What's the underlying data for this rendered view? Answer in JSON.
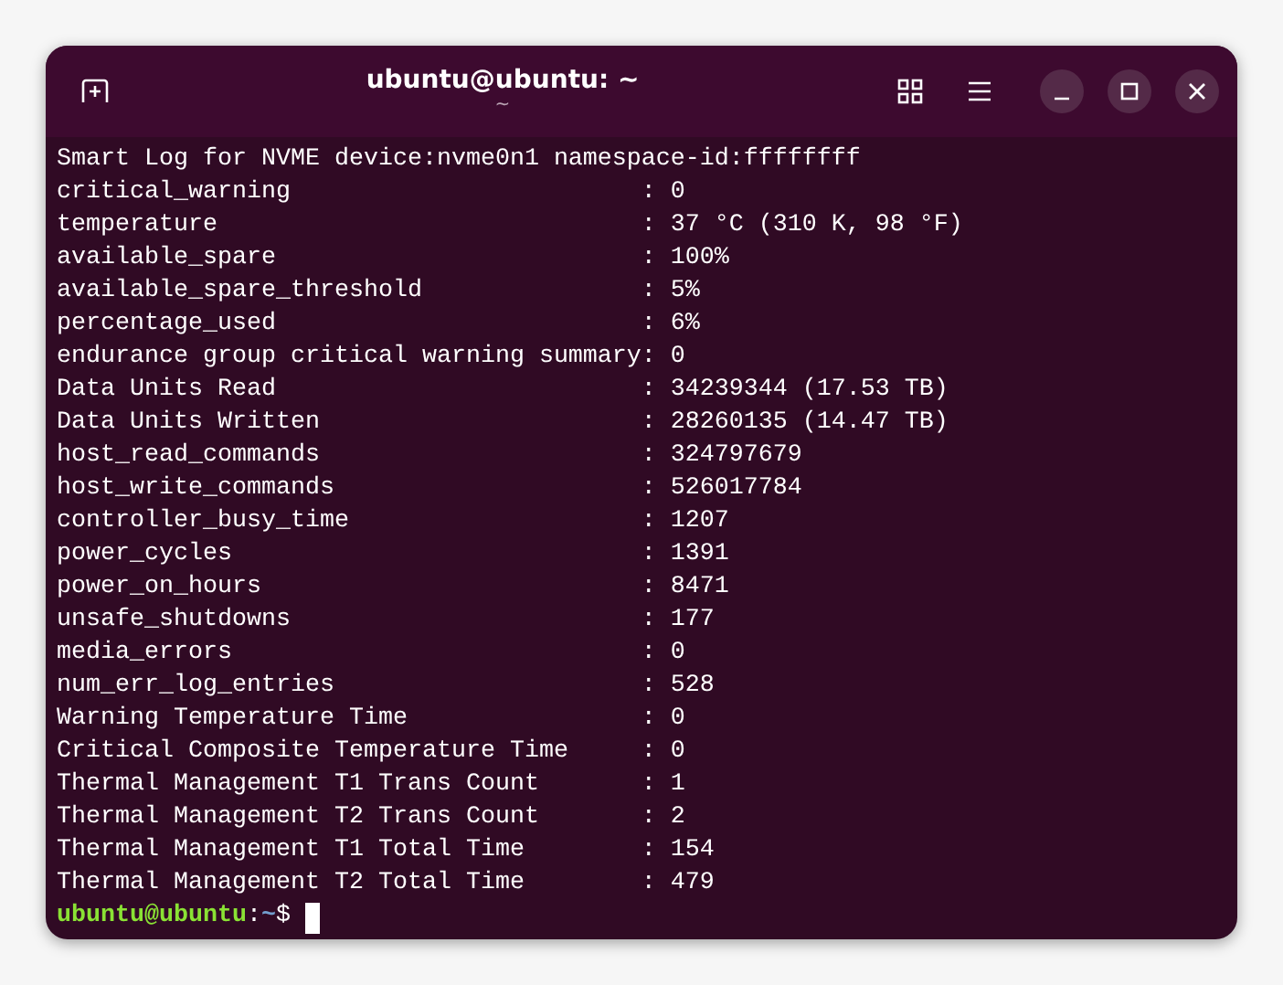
{
  "window": {
    "title": "ubuntu@ubuntu: ~",
    "subtitle": "~"
  },
  "terminal": {
    "lines": [
      "Smart Log for NVME device:nvme0n1 namespace-id:ffffffff",
      "critical_warning                        : 0",
      "temperature                             : 37 °C (310 K, 98 °F)",
      "available_spare                         : 100%",
      "available_spare_threshold               : 5%",
      "percentage_used                         : 6%",
      "endurance group critical warning summary: 0",
      "Data Units Read                         : 34239344 (17.53 TB)",
      "Data Units Written                      : 28260135 (14.47 TB)",
      "host_read_commands                      : 324797679",
      "host_write_commands                     : 526017784",
      "controller_busy_time                    : 1207",
      "power_cycles                            : 1391",
      "power_on_hours                          : 8471",
      "unsafe_shutdowns                        : 177",
      "media_errors                            : 0",
      "num_err_log_entries                     : 528",
      "Warning Temperature Time                : 0",
      "Critical Composite Temperature Time     : 0",
      "Thermal Management T1 Trans Count       : 1",
      "Thermal Management T2 Trans Count       : 2",
      "Thermal Management T1 Total Time        : 154",
      "Thermal Management T2 Total Time        : 479"
    ],
    "prompt": {
      "user_host": "ubuntu@ubuntu",
      "separator": ":",
      "path": "~",
      "symbol": "$"
    }
  }
}
